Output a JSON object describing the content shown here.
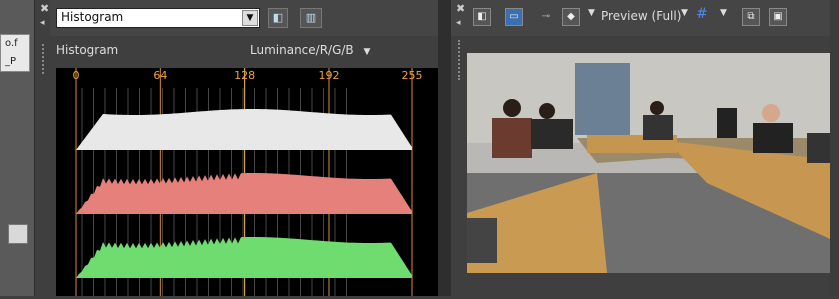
{
  "left_clipped": {
    "items": [
      "o.f",
      "_P"
    ]
  },
  "histogram_panel": {
    "view_select": "Histogram",
    "title": "Histogram",
    "mode": "Luminance/R/G/B",
    "ticks": [
      "0",
      "64",
      "128",
      "192",
      "255"
    ]
  },
  "preview_toolbar": {
    "quality": "Preview (Full)"
  },
  "colors": {
    "luminance": "#e8e8e8",
    "red": "#e5807a",
    "green": "#6fdc6f",
    "tick_line": "#d98c3a",
    "center_line": "#f2c15a"
  }
}
